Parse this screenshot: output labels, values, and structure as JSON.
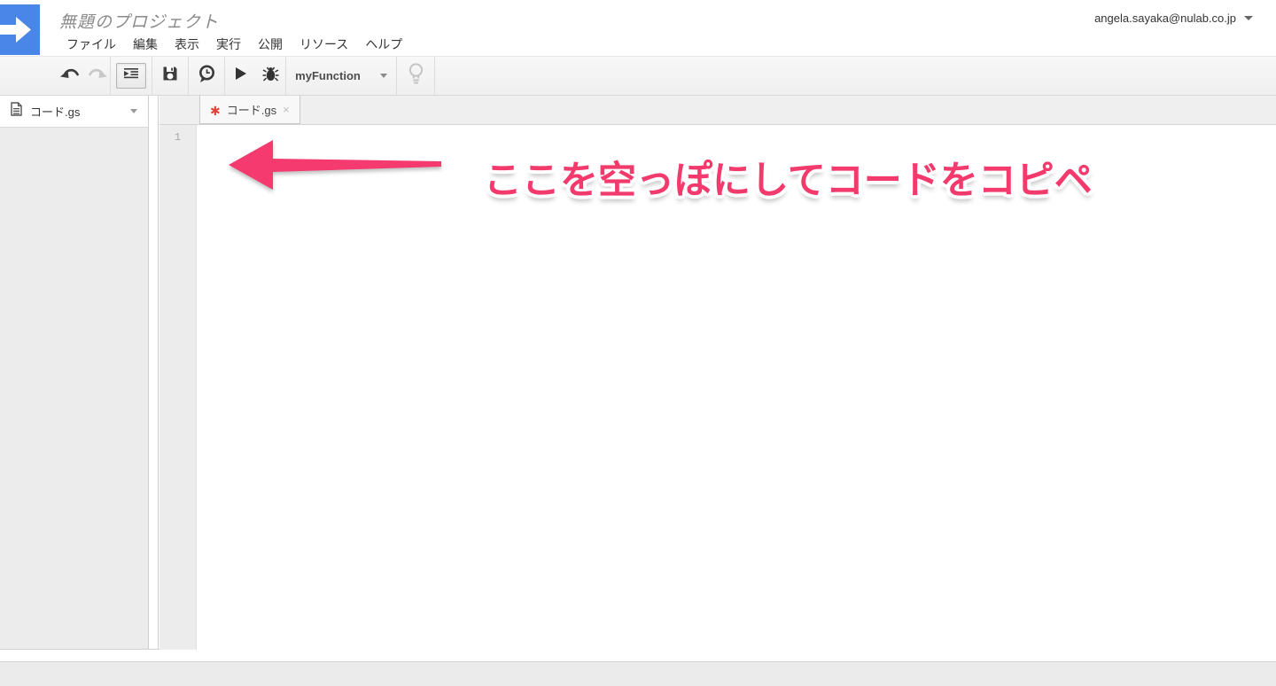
{
  "header": {
    "project_title": "無題のプロジェクト",
    "menu_items": [
      "ファイル",
      "編集",
      "表示",
      "実行",
      "公開",
      "リソース",
      "ヘルプ"
    ],
    "account_email": "angela.sayaka@nulab.co.jp"
  },
  "toolbar": {
    "function_selector_value": "myFunction",
    "icon_names": [
      "undo-icon",
      "redo-icon",
      "indent-icon",
      "save-icon",
      "execution-history-icon",
      "run-icon",
      "debug-icon",
      "lightbulb-icon"
    ]
  },
  "sidebar": {
    "files": [
      {
        "name": "コード.gs"
      }
    ]
  },
  "editor": {
    "tabs": [
      {
        "dirty_marker": "✱",
        "label": "コード.gs",
        "close_label": "×",
        "active": true
      }
    ],
    "line_numbers": [
      "1"
    ],
    "annotation": {
      "text": "ここを空っぽにしてコードをコピペ"
    }
  },
  "colors": {
    "logo_blue": "#4a86e8",
    "annotation_pink": "#f33a6d",
    "dirty_marker_red": "#e0443e"
  }
}
